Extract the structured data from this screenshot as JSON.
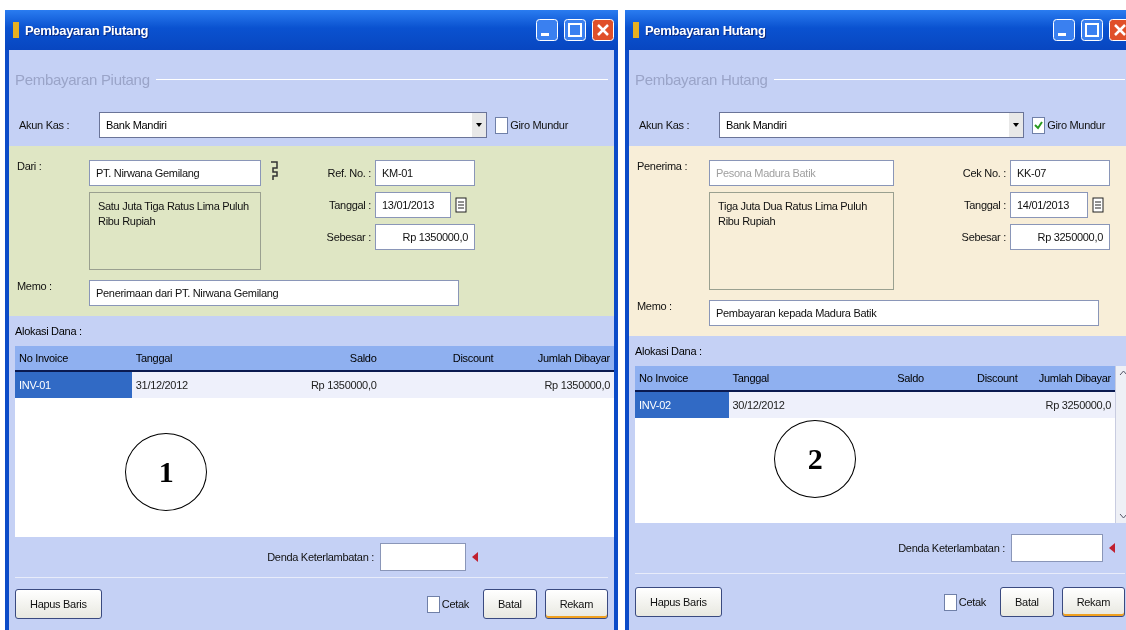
{
  "windows": [
    {
      "title": "Pembayaran Piutang",
      "heading": "Pembayaran Piutang",
      "color": "#dfe6c4",
      "account": {
        "label": "Akun Kas :",
        "value": "Bank Mandiri"
      },
      "giro": {
        "label": "Giro Mundur",
        "checked": false
      },
      "party": {
        "label": "Dari :",
        "value": "PT. Nirwana Gemilang",
        "disabled": false,
        "lookup": true
      },
      "words": "Satu Juta Tiga Ratus Lima Puluh Ribu Rupiah",
      "ref": {
        "label": "Ref. No. :",
        "value": "KM-01"
      },
      "date": {
        "label": "Tanggal :",
        "value": "13/01/2013"
      },
      "amount": {
        "label": "Sebesar :",
        "value": "Rp 1350000,0"
      },
      "memo": {
        "label": "Memo :",
        "value": "Penerimaan dari PT. Nirwana Gemilang"
      },
      "allocation_label": "Alokasi Dana :",
      "table": {
        "columns": [
          "No Invoice",
          "Tanggal",
          "Saldo",
          "Discount",
          "Jumlah Dibayar"
        ],
        "rows": [
          {
            "selected": true,
            "cells": [
              "INV-01",
              "31/12/2012",
              "Rp 1350000,0",
              null,
              "Rp 1350000,0"
            ]
          }
        ],
        "scrollbar": false
      },
      "penalty_label": "Denda Keterlambatan :",
      "delete_button": "Hapus Baris",
      "print": {
        "label": "Cetak",
        "checked": false
      },
      "buttons": [
        {
          "label": "Batal",
          "kind": "normal"
        },
        {
          "label": "Rekam",
          "kind": "default"
        }
      ],
      "annotation": "1"
    },
    {
      "title": "Pembayaran Hutang",
      "heading": "Pembayaran Hutang",
      "color": "#f8eed8",
      "account": {
        "label": "Akun Kas :",
        "value": "Bank Mandiri"
      },
      "giro": {
        "label": "Giro Mundur",
        "checked": true
      },
      "party": {
        "label": "Penerima :",
        "value": "Pesona Madura Batik",
        "disabled": true,
        "lookup": false
      },
      "words": "Tiga Juta Dua Ratus Lima Puluh Ribu Rupiah",
      "ref": {
        "label": "Cek No. :",
        "value": "KK-07"
      },
      "date": {
        "label": "Tanggal :",
        "value": "14/01/2013"
      },
      "amount": {
        "label": "Sebesar :",
        "value": "Rp 3250000,0"
      },
      "memo": {
        "label": "Memo :",
        "value": "Pembayaran kepada Madura Batik"
      },
      "allocation_label": "Alokasi Dana :",
      "table": {
        "columns": [
          "No Invoice",
          "Tanggal",
          "Saldo",
          "Discount",
          "Jumlah Dibayar"
        ],
        "rows": [
          {
            "selected": true,
            "cells": [
              "INV-02",
              "30/12/2012",
              null,
              null,
              "Rp 3250000,0"
            ]
          }
        ],
        "scrollbar": true
      },
      "penalty_label": "Denda Keterlambatan :",
      "delete_button": "Hapus Baris",
      "print": {
        "label": "Cetak",
        "checked": false
      },
      "buttons": [
        {
          "label": "Batal",
          "kind": "normal"
        },
        {
          "label": "Rekam",
          "kind": "default"
        }
      ],
      "annotation": "2"
    }
  ]
}
